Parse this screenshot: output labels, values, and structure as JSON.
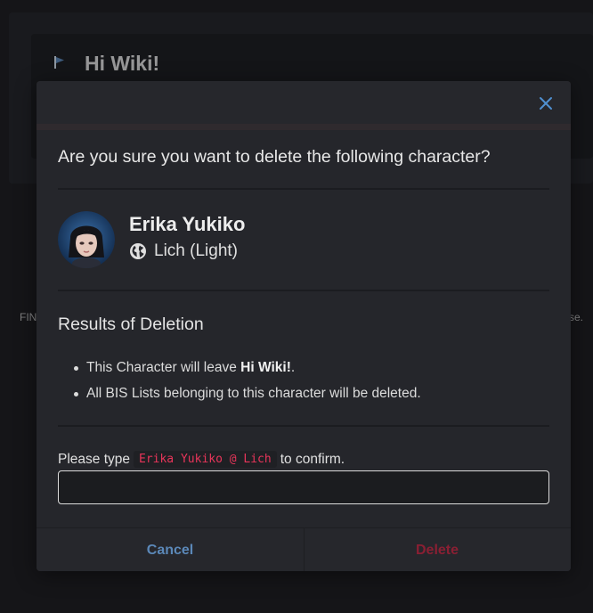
{
  "background": {
    "group_name": "Hi Wiki!",
    "left_text": "FIN",
    "right_text": "se."
  },
  "modal": {
    "question": "Are you sure you want to delete the following character?",
    "character": {
      "name": "Erika Yukiko",
      "world": "Lich (Light)"
    },
    "results_title": "Results of Deletion",
    "results": {
      "item1_prefix": "This Character will leave ",
      "item1_bold": "Hi Wiki!",
      "item1_suffix": ".",
      "item2": "All BIS Lists belonging to this character will be deleted."
    },
    "confirm": {
      "prefix": "Please type",
      "code": "Erika Yukiko @ Lich",
      "suffix": "to confirm.",
      "value": ""
    },
    "buttons": {
      "cancel": "Cancel",
      "delete": "Delete"
    }
  },
  "colors": {
    "accent_blue": "#5b88b8",
    "danger": "#8a1f33",
    "code_text": "#e8355a"
  },
  "icons": {
    "close": "close-icon",
    "globe": "globe-icon",
    "flag": "flag-icon"
  }
}
